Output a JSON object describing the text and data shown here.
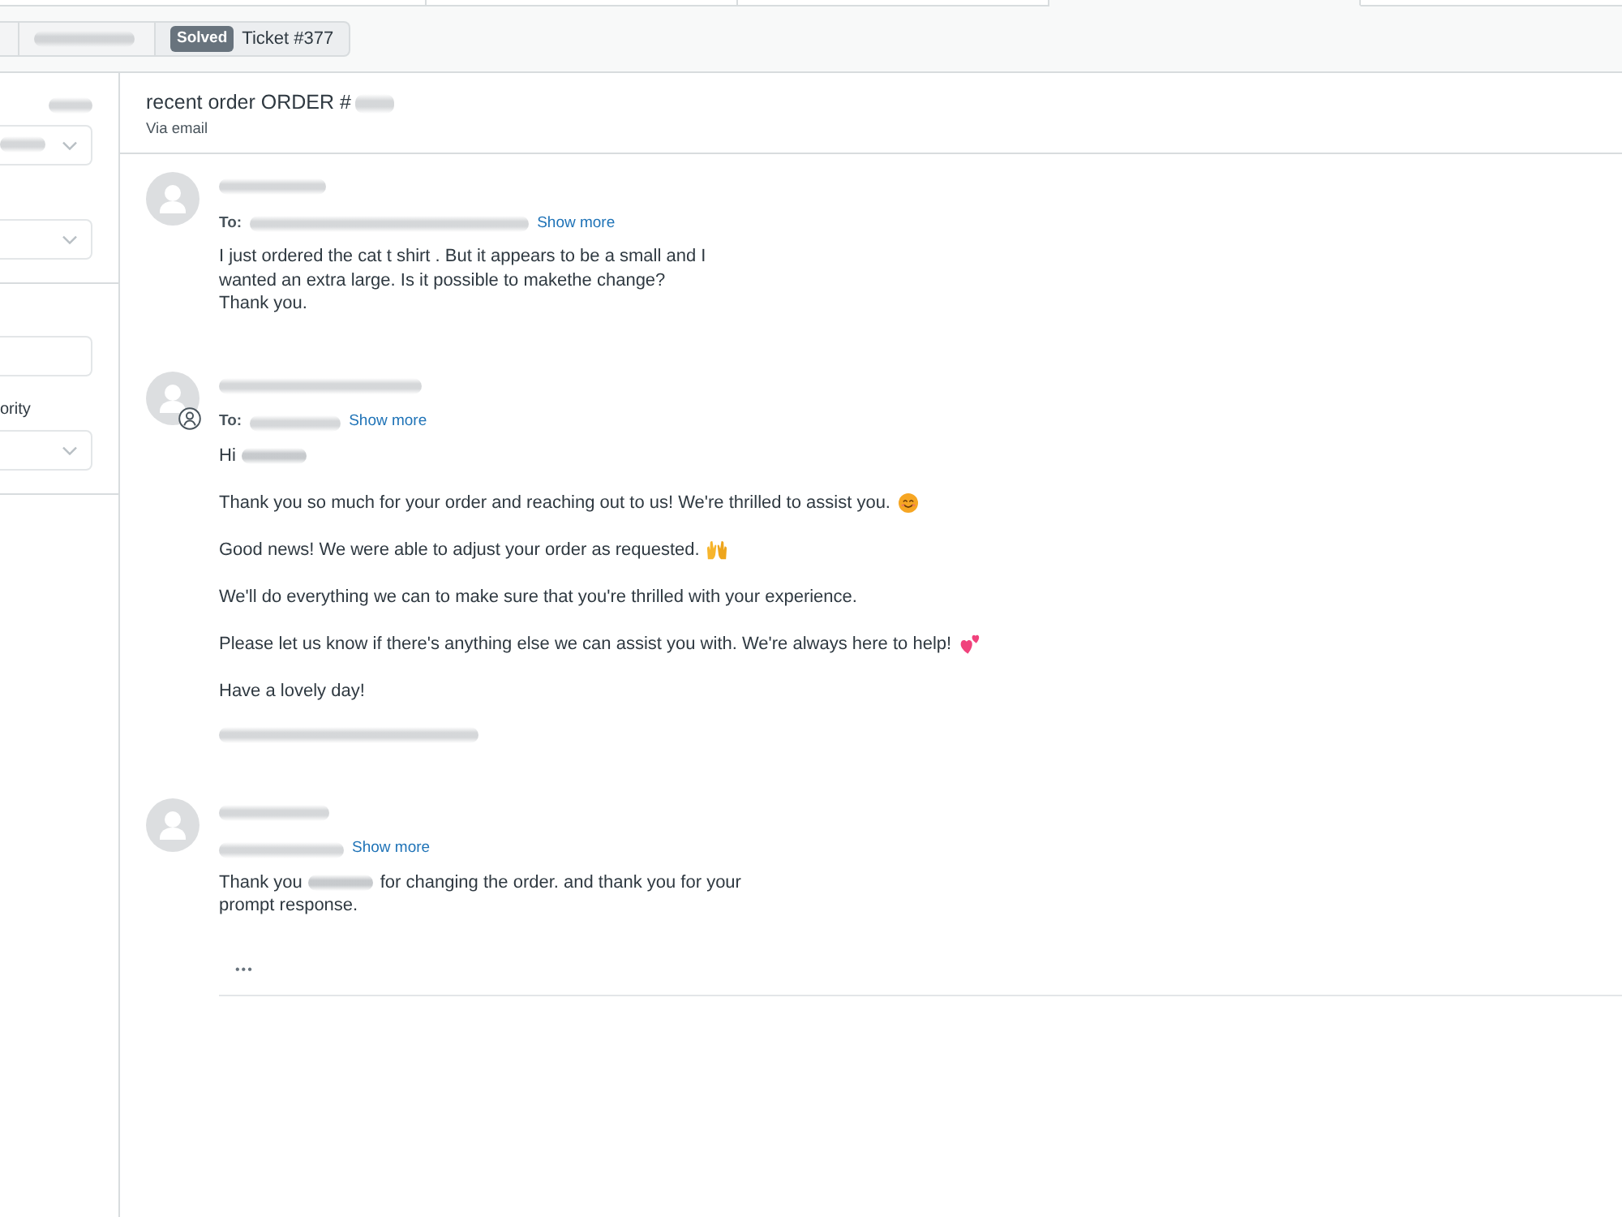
{
  "app_tabs": [
    {
      "selected": false
    },
    {
      "selected": false
    },
    {
      "selected": false
    },
    {
      "selected": true
    },
    {
      "selected": false
    }
  ],
  "breadcrumbs": [
    {
      "kind": "partial"
    },
    {
      "kind": "redacted"
    },
    {
      "kind": "ticket",
      "status": "Solved",
      "label": "Ticket #377"
    }
  ],
  "sidebar": {
    "sections": [
      {
        "fields": [
          {
            "kind": "select",
            "label_redacted": true,
            "value_redacted": true
          },
          {
            "kind": "select",
            "label_redacted": false,
            "value_redacted": false
          }
        ]
      },
      {
        "fields": [
          {
            "kind": "input",
            "label_redacted": false,
            "value_redacted": false
          },
          {
            "kind": "select",
            "label": "ority",
            "label_redacted": false,
            "value_redacted": false
          }
        ]
      }
    ]
  },
  "ticket": {
    "subject": [
      {
        "kind": "text",
        "text": "recent order ORDER #"
      },
      {
        "kind": "redacted"
      }
    ],
    "channel": "Via email"
  },
  "messages": [
    {
      "agent": false,
      "sender_redacted": true,
      "to_label": "To:",
      "recipients_redacted": true,
      "show_more": "Show more",
      "body": [
        {
          "kind": "plain",
          "segments": [
            {
              "kind": "text",
              "text": "I just ordered the cat t shirt . But it appears to be a small and I\nwanted an extra large. Is it possible to makethe change?\nThank you."
            }
          ]
        }
      ]
    },
    {
      "agent": true,
      "sender_redacted": true,
      "to_label": "To:",
      "recipients_redacted": true,
      "show_more": "Show more",
      "body": [
        {
          "kind": "plain",
          "segments": [
            {
              "kind": "text",
              "text": "Hi"
            },
            {
              "kind": "redacted"
            }
          ]
        },
        {
          "kind": "smile",
          "segments": [
            {
              "kind": "text",
              "text": "Thank you so much for your order and reaching out to us! We're thrilled to assist you."
            }
          ]
        },
        {
          "kind": "hands",
          "segments": [
            {
              "kind": "text",
              "text": "Good news! We were able to adjust your order as requested."
            }
          ]
        },
        {
          "kind": "plain",
          "segments": [
            {
              "kind": "text",
              "text": "We'll do everything we can to make sure that you're thrilled with your experience."
            }
          ]
        },
        {
          "kind": "hearts",
          "segments": [
            {
              "kind": "text",
              "text": "Please let us know if there's anything else we can assist you with. We're always here to help!"
            }
          ]
        },
        {
          "kind": "plain",
          "segments": [
            {
              "kind": "text",
              "text": "Have a lovely day!"
            }
          ]
        },
        {
          "kind": "plain",
          "segments": [
            {
              "kind": "redacted"
            }
          ]
        }
      ]
    },
    {
      "agent": false,
      "sender_redacted": true,
      "recipients_redacted": true,
      "show_more": "Show more",
      "body": [
        {
          "kind": "plain",
          "segments": [
            {
              "kind": "text",
              "text": "Thank you"
            },
            {
              "kind": "redacted"
            },
            {
              "kind": "text",
              "text": "for changing the order. and thank you for your\nprompt response."
            }
          ]
        }
      ],
      "quoted_toggle": "•••"
    }
  ]
}
